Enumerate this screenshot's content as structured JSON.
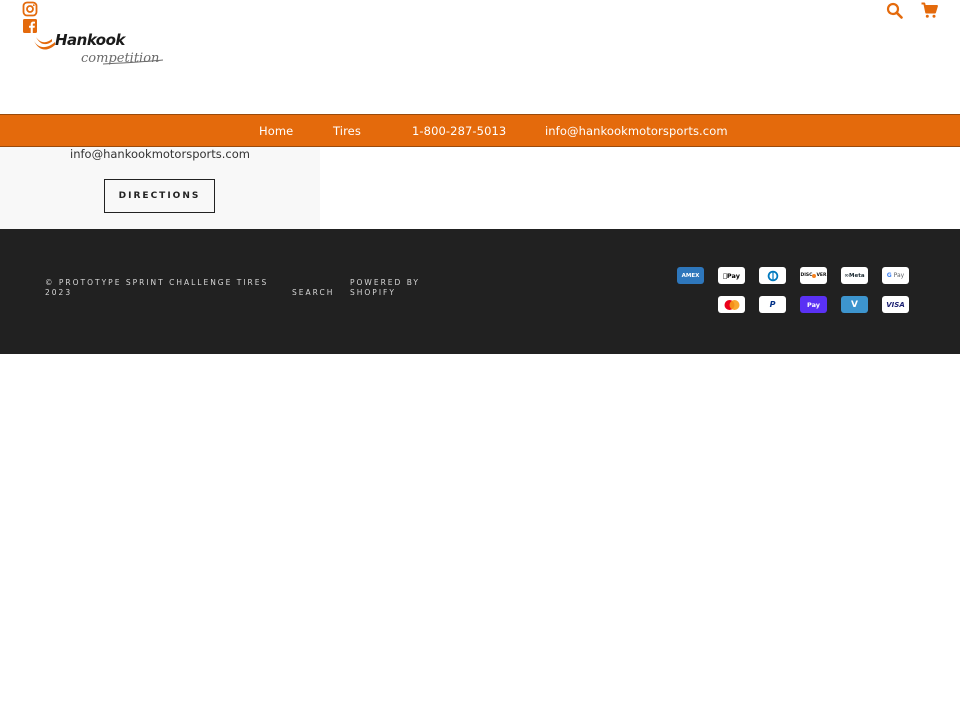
{
  "header": {
    "brand": "Hankook",
    "brand_sub": "competition",
    "icons": [
      "instagram-icon",
      "facebook-icon",
      "search-icon",
      "cart-icon"
    ]
  },
  "nav": {
    "home": "Home",
    "tires": "Tires",
    "phone": "1-800-287-5013",
    "email": "info@hankookmotorsports.com"
  },
  "contact": {
    "email": "info@hankookmotorsports.com",
    "directions_label": "DIRECTIONS"
  },
  "footer": {
    "copyright_line1": "© PROTOTYPE SPRINT CHALLENGE TIRES",
    "copyright_line2": "2023",
    "search_label": "SEARCH",
    "powered_line1": "POWERED BY",
    "powered_line2": "SHOPIFY",
    "payments_row1": [
      "American Express",
      "Apple Pay",
      "Diners Club",
      "Discover",
      "Meta Pay",
      "Google Pay"
    ],
    "payments_row2": [
      "Mastercard",
      "PayPal",
      "Shop Pay",
      "Venmo",
      "Visa"
    ]
  },
  "colors": {
    "accent": "#e46a0c",
    "footer_bg": "#212121",
    "panel_bg": "#f8f8f8"
  }
}
